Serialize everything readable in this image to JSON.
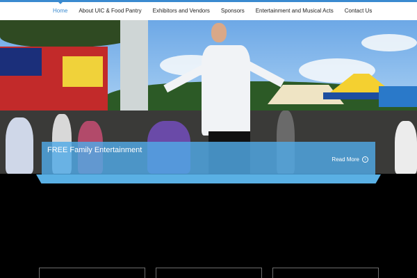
{
  "nav": {
    "items": [
      {
        "label": "Home",
        "active": true
      },
      {
        "label": "About UIC & Food Pantry",
        "active": false
      },
      {
        "label": "Exhibitors and Vendors",
        "active": false
      },
      {
        "label": "Sponsors",
        "active": false
      },
      {
        "label": "Entertainment and Musical Acts",
        "active": false
      },
      {
        "label": "Contact Us",
        "active": false
      }
    ],
    "accent_color": "#3a8ad0"
  },
  "hero": {
    "caption_title": "FREE Family Entertainment",
    "read_more_label": "Read More",
    "read_more_icon": "arrow-right-circle-icon",
    "caption_color": "#50aae6"
  },
  "feature_boxes": [
    {
      "label": ""
    },
    {
      "label": ""
    },
    {
      "label": ""
    }
  ]
}
